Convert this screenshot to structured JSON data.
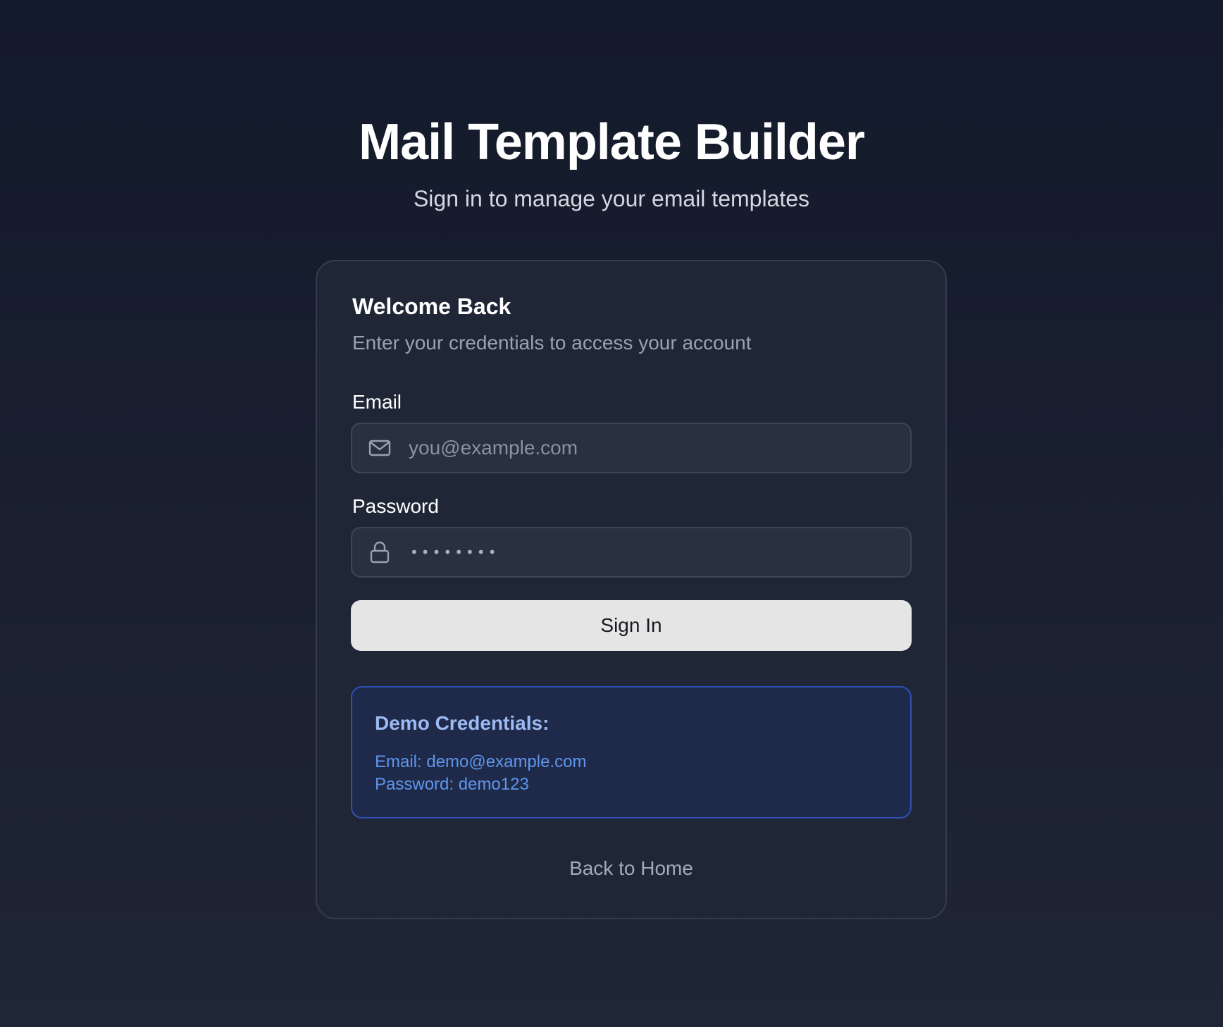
{
  "header": {
    "title": "Mail Template Builder",
    "subtitle": "Sign in to manage your email templates"
  },
  "card": {
    "title": "Welcome Back",
    "subtitle": "Enter your credentials to access your account"
  },
  "form": {
    "email": {
      "label": "Email",
      "placeholder": "you@example.com",
      "value": "",
      "icon": "mail-icon"
    },
    "password": {
      "label": "Password",
      "masked_value": "••••••••",
      "icon": "lock-icon"
    },
    "submit_label": "Sign In"
  },
  "demo": {
    "title": "Demo Credentials:",
    "email_line": "Email: demo@example.com",
    "password_line": "Password: demo123"
  },
  "footer": {
    "back_link": "Back to Home"
  },
  "colors": {
    "background_top": "#131a2b",
    "background_bottom": "#1f2636",
    "card_bg": "#1f2737",
    "input_bg": "#283140",
    "button_bg": "#e5e5e5",
    "demo_bg": "#1f2a4a",
    "demo_border": "#2f4fb8",
    "demo_title": "#9dbaf3",
    "demo_text": "#5f95ea"
  }
}
